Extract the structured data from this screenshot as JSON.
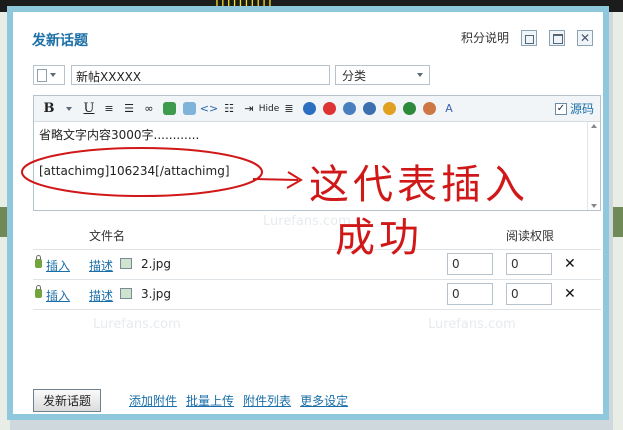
{
  "dialog": {
    "title": "发新话题",
    "points_help": "积分说明"
  },
  "form": {
    "subject_value": "新帖XXXXX",
    "category_selected": "分类"
  },
  "editor": {
    "source_label": "源码",
    "source_checked": true,
    "hide_label": "Hide",
    "content_line1": "省略文字内容3000字............",
    "content_line2": "[attachimg]106234[/attachimg]"
  },
  "annotation": {
    "handwritten_line1": "这代表插入",
    "handwritten_line2": "成功",
    "color": "#d01818"
  },
  "attachments": {
    "col_filename": "文件名",
    "col_read_permission": "阅读权限",
    "rows": [
      {
        "insert": "插入",
        "describe": "描述",
        "filename": "2.jpg",
        "price": "0",
        "permission": "0",
        "delete": "✕"
      },
      {
        "insert": "插入",
        "describe": "描述",
        "filename": "3.jpg",
        "price": "0",
        "permission": "0",
        "delete": "✕"
      }
    ]
  },
  "footer": {
    "post_button": "发新话题",
    "links": [
      "添加附件",
      "批量上传",
      "附件列表",
      "更多设定"
    ]
  },
  "watermark": "Lurefans.com",
  "colors": {
    "title_blue": "#1a6fa8",
    "dialog_border": "#8fc7dc",
    "link_blue": "#1a6fa8"
  }
}
